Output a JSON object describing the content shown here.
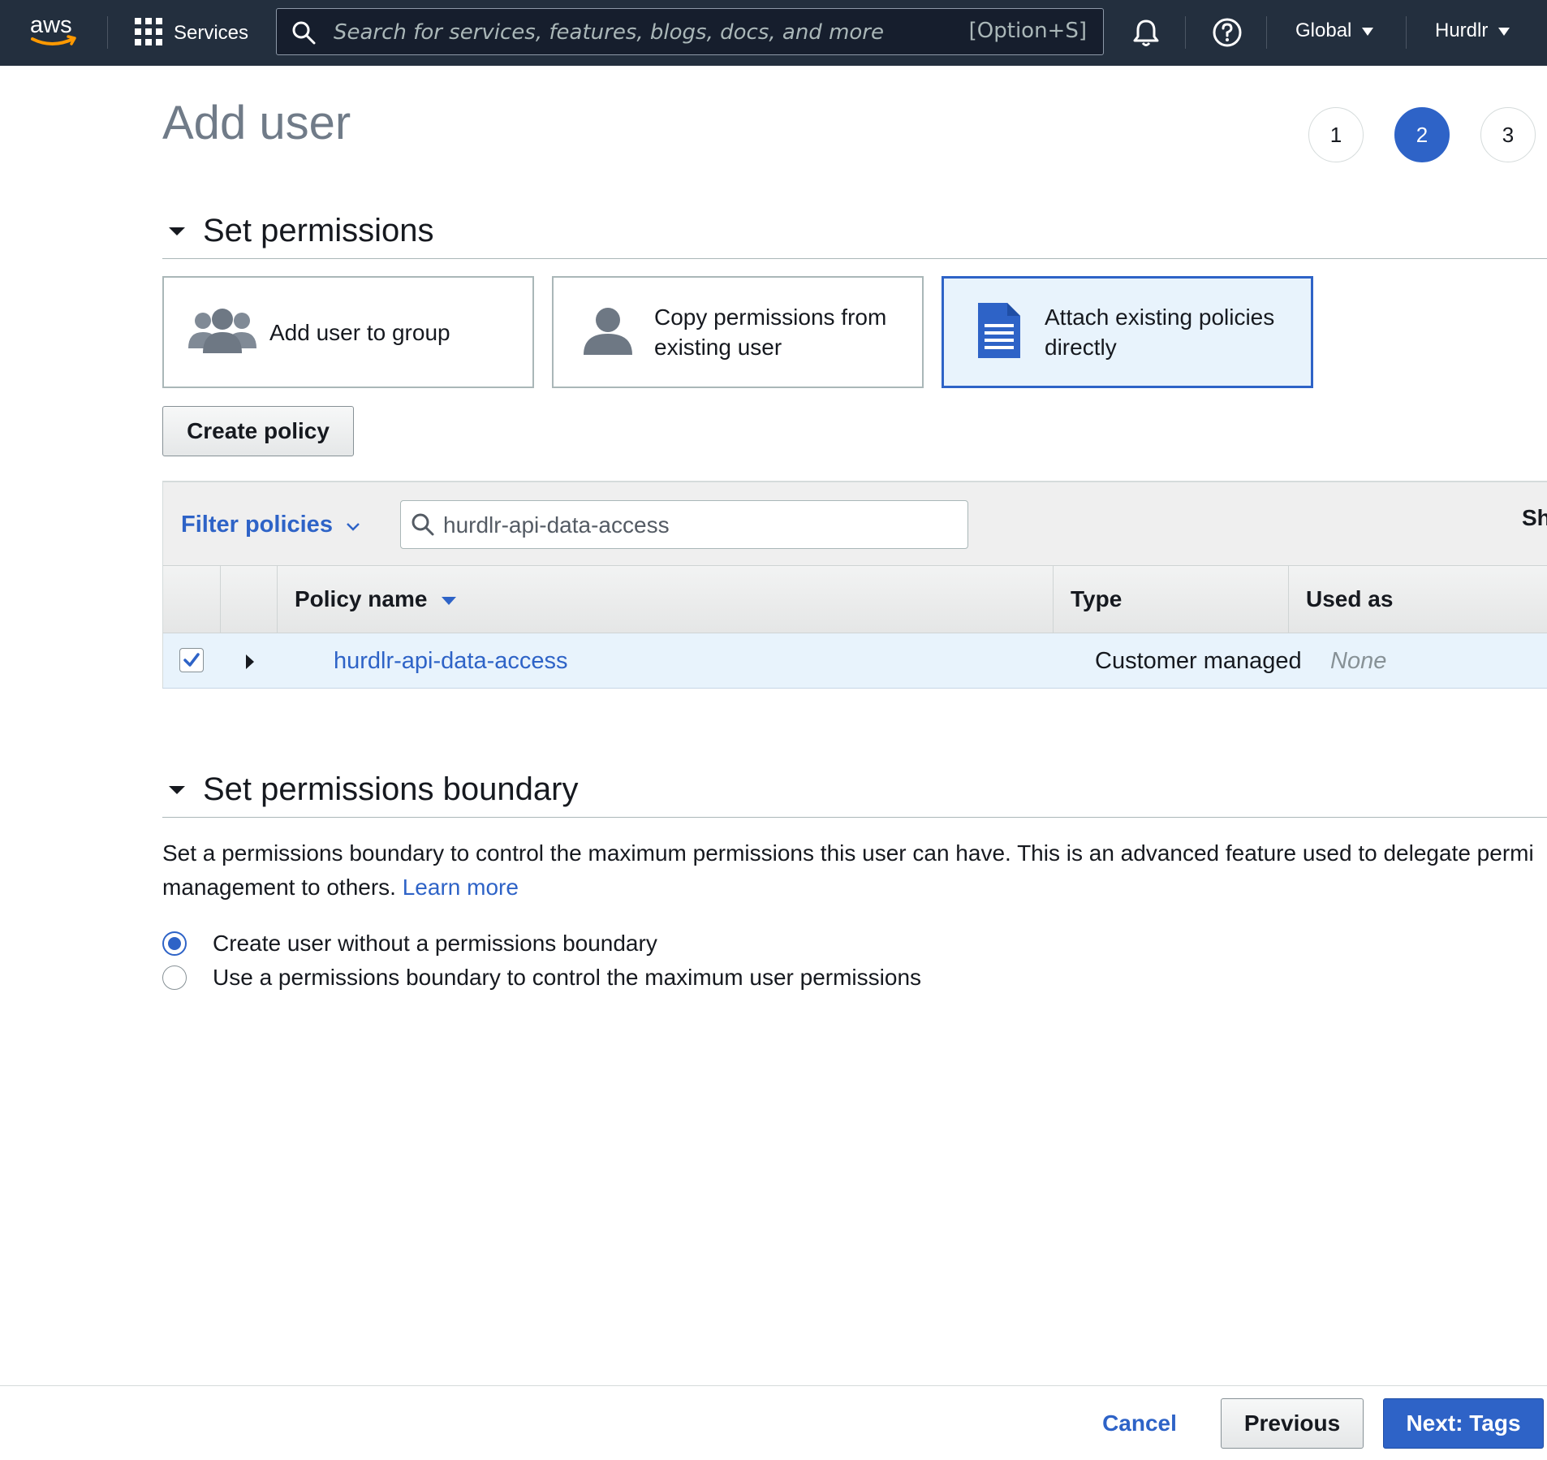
{
  "nav": {
    "services_label": "Services",
    "search_placeholder": "Search for services, features, blogs, docs, and more",
    "search_shortcut": "[Option+S]",
    "region": "Global",
    "account": "Hurdlr"
  },
  "header": {
    "title": "Add user",
    "steps": [
      "1",
      "2",
      "3"
    ],
    "active_step": 2
  },
  "permissions": {
    "heading": "Set permissions",
    "options": [
      {
        "label": "Add user to group",
        "icon": "group-icon",
        "selected": false
      },
      {
        "label": "Copy permissions from existing user",
        "icon": "user-icon",
        "selected": false
      },
      {
        "label": "Attach existing policies directly",
        "icon": "document-icon",
        "selected": true
      }
    ],
    "create_policy_label": "Create policy"
  },
  "policy_table": {
    "filter_label": "Filter policies",
    "search_value": "hurdlr-api-data-access",
    "partial_right_label": "Sh",
    "columns": [
      "Policy name",
      "Type",
      "Used as"
    ],
    "rows": [
      {
        "checked": true,
        "name": "hurdlr-api-data-access",
        "type": "Customer managed",
        "used_as": "None"
      }
    ]
  },
  "boundary": {
    "heading": "Set permissions boundary",
    "description_line1": "Set a permissions boundary to control the maximum permissions this user can have. This is an advanced feature used to delegate permi",
    "description_line2": "management to others.",
    "learn_more": "Learn more",
    "options": [
      {
        "label": "Create user without a permissions boundary",
        "selected": true
      },
      {
        "label": "Use a permissions boundary to control the maximum user permissions",
        "selected": false
      }
    ]
  },
  "footer": {
    "cancel_label": "Cancel",
    "previous_label": "Previous",
    "next_label": "Next: Tags"
  },
  "colors": {
    "nav_bg": "#232f3e",
    "accent": "#2e63c7",
    "selected_bg": "#e8f3fc",
    "aws_orange": "#ff9900"
  }
}
